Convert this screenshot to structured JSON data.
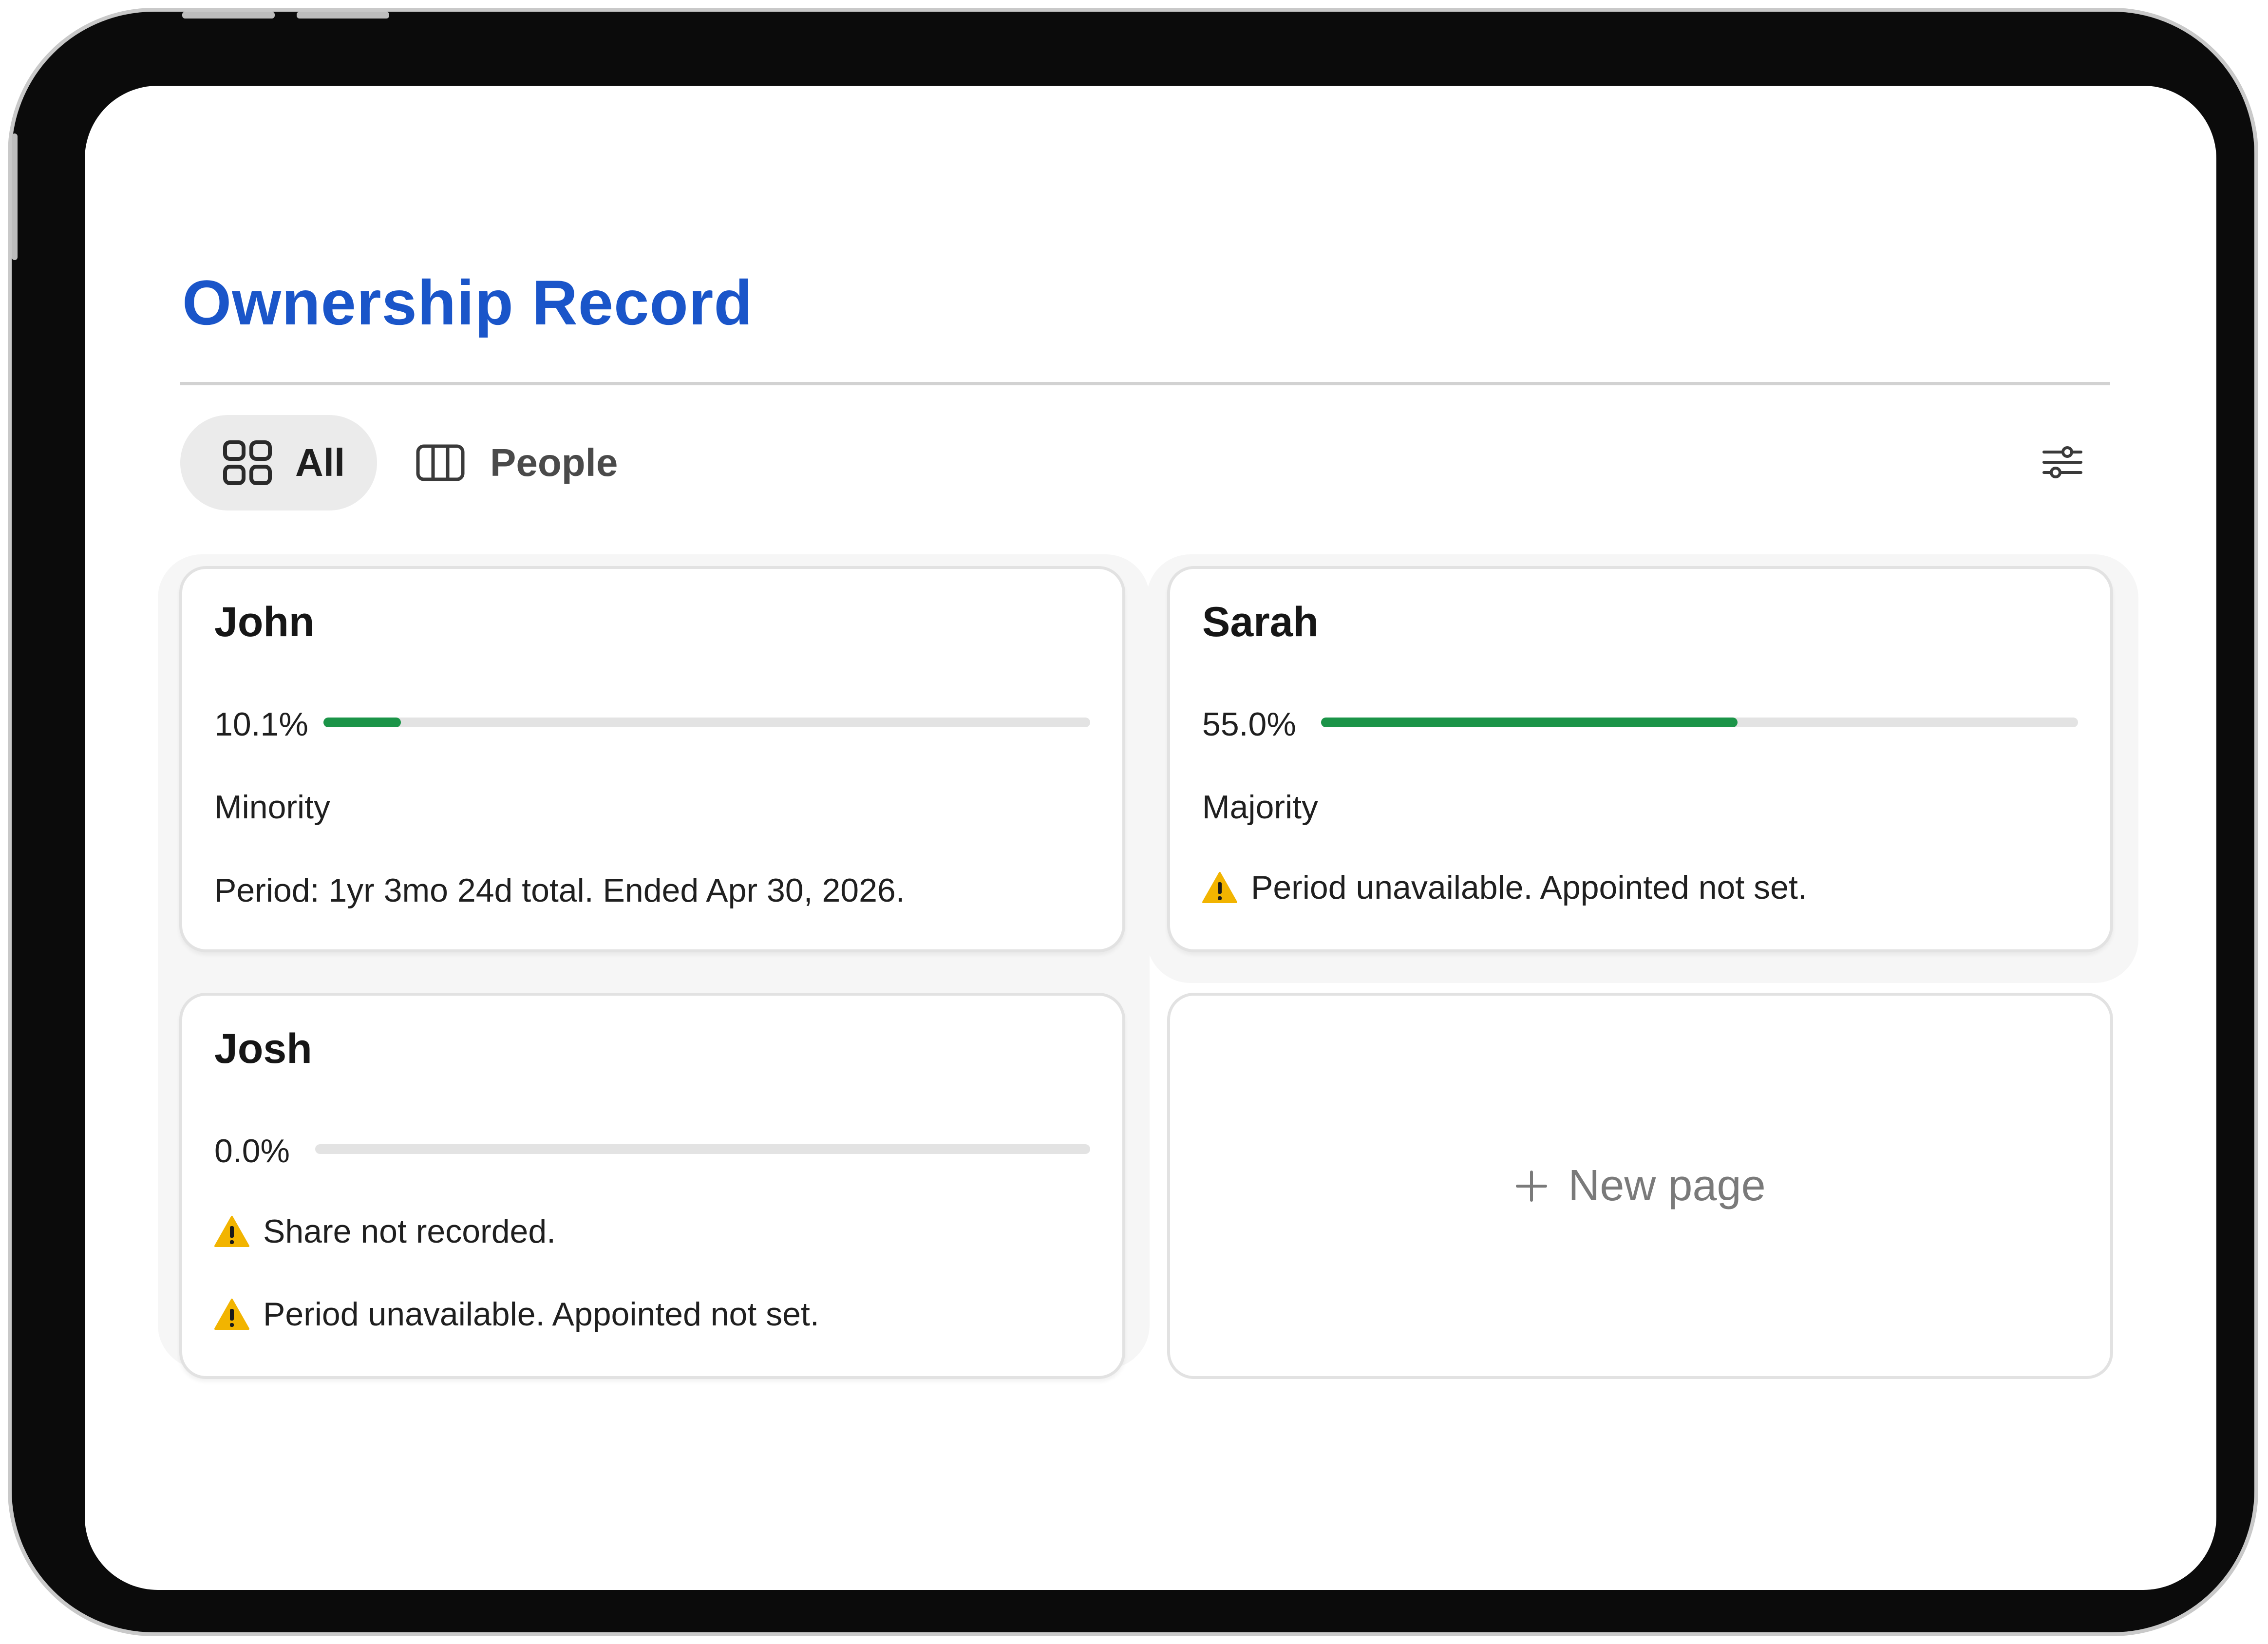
{
  "page": {
    "title": "Ownership Record"
  },
  "view_tabs": [
    {
      "label": "All",
      "icon": "grid-icon",
      "active": true
    },
    {
      "label": "People",
      "icon": "columns-icon",
      "active": false
    }
  ],
  "toolbar": {
    "settings_icon": "sliders-icon"
  },
  "cards": [
    {
      "name": "John",
      "share_label": "10.1%",
      "share_value": 10.1,
      "bar_color": "#1b9448",
      "status": "Minority",
      "period": "Period: 1yr 3mo 24d total. Ended Apr 30, 2026."
    },
    {
      "name": "Sarah",
      "share_label": "55.0%",
      "share_value": 55.0,
      "bar_color": "#1b9448",
      "status": "Majority",
      "period_warning": "Period unavailable. Appointed not set."
    },
    {
      "name": "Josh",
      "share_label": "0.0%",
      "share_value": 0.0,
      "bar_color": "#1b9448",
      "share_warning": "Share not recorded.",
      "period_warning": "Period unavailable. Appointed not set."
    }
  ],
  "new_page": {
    "label": "New page",
    "icon": "plus-icon"
  },
  "colors": {
    "accent": "#1a55c9",
    "progress": "#1b9448",
    "warning": "#f2b400"
  }
}
